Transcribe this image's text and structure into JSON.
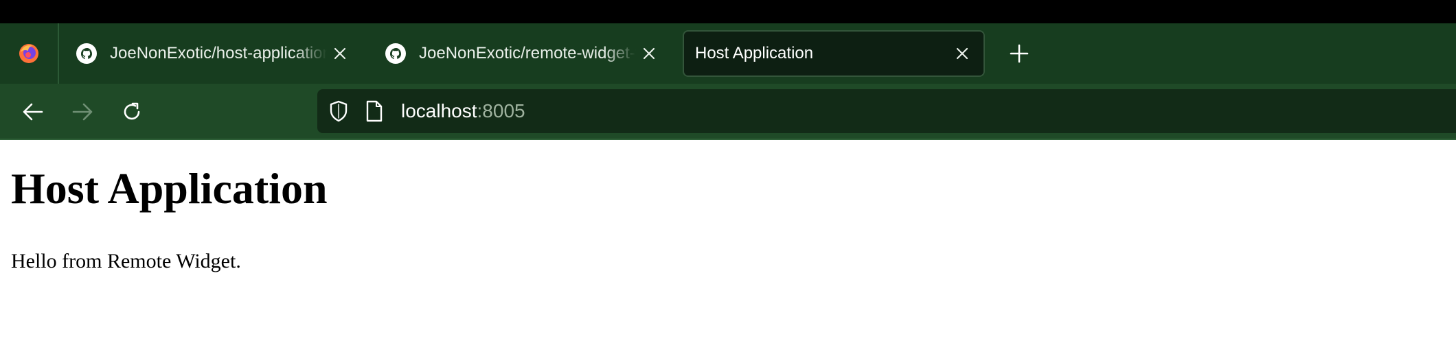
{
  "browser": {
    "tabs": [
      {
        "title": "JoeNonExotic/host-application-f",
        "icon": "github-icon",
        "active": false
      },
      {
        "title": "JoeNonExotic/remote-widget-fo",
        "icon": "github-icon",
        "active": false
      },
      {
        "title": "Host Application",
        "icon": "",
        "active": true
      }
    ],
    "address": {
      "host": "localhost",
      "port": ":8005"
    },
    "icons": {
      "app_menu": "firefox-icon",
      "new_tab": "plus-icon",
      "back": "arrow-left-icon",
      "forward": "arrow-right-icon",
      "reload": "reload-icon",
      "tracking": "shield-icon",
      "page_info": "page-icon"
    },
    "colors": {
      "toolbar": "#1f4a27",
      "tabstrip": "#173d1f",
      "active_tab": "#0d1f12"
    }
  },
  "page": {
    "heading": "Host Application",
    "paragraph": "Hello from Remote Widget."
  }
}
